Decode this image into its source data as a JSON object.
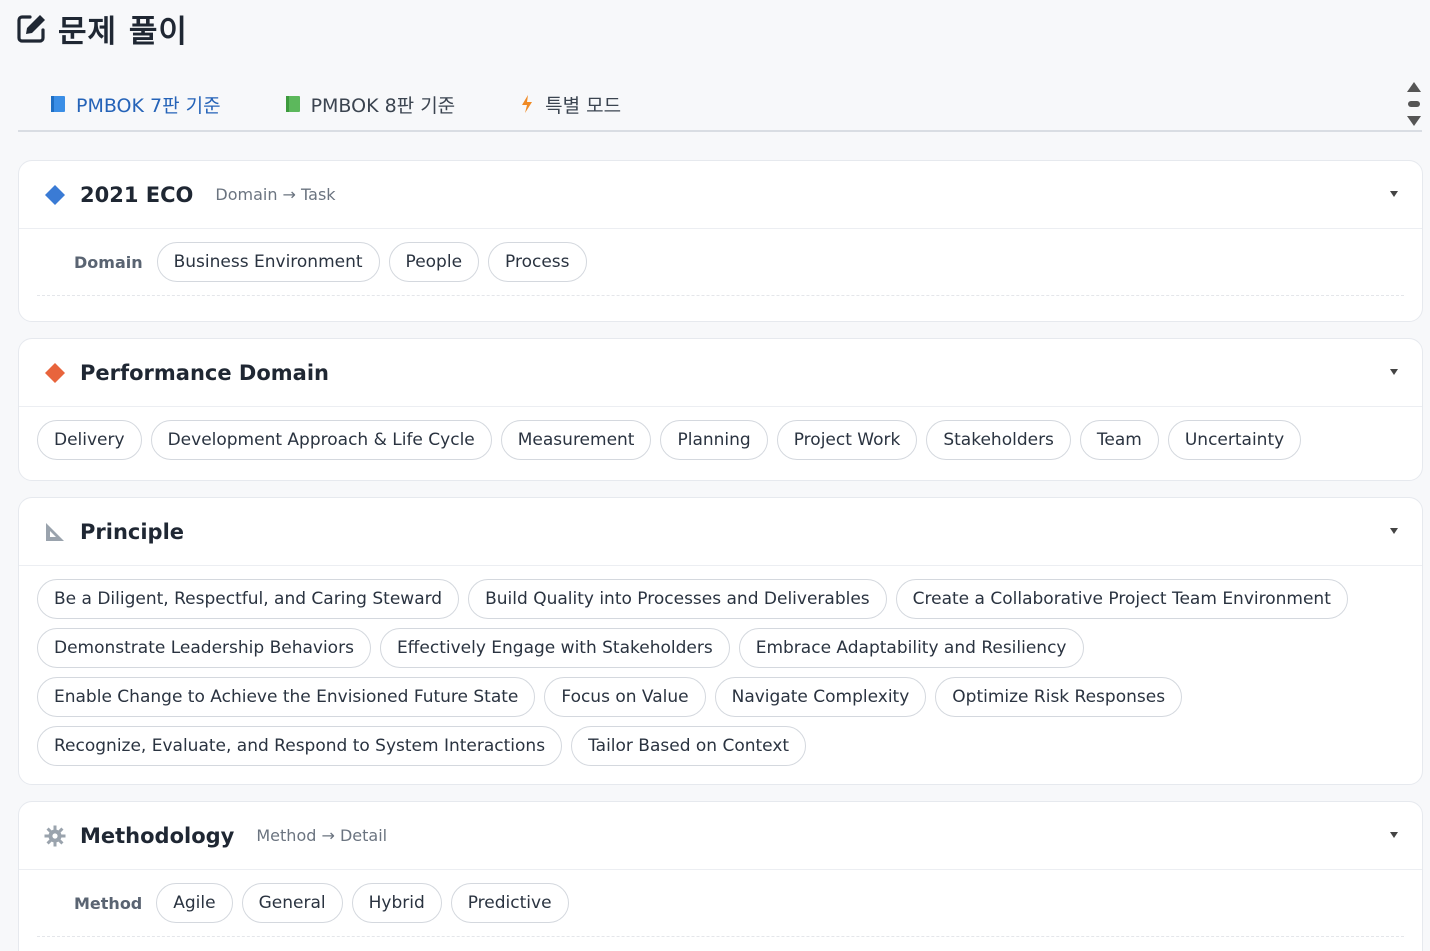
{
  "page": {
    "title": "문제 풀이",
    "title_icon": "edit-icon"
  },
  "tabs": [
    {
      "label": "PMBOK 7판 기준",
      "icon": "blue-book-icon",
      "active": true
    },
    {
      "label": "PMBOK 8판 기준",
      "icon": "green-book-icon",
      "active": false
    },
    {
      "label": "특별 모드",
      "icon": "lightning-icon",
      "active": false
    }
  ],
  "sections": {
    "eco": {
      "title": "2021 ECO",
      "subtitle": "Domain → Task",
      "icon": "blue-diamond-icon",
      "row_label": "Domain",
      "chips": [
        "Business Environment",
        "People",
        "Process"
      ]
    },
    "performance": {
      "title": "Performance Domain",
      "icon": "orange-diamond-icon",
      "chips": [
        "Delivery",
        "Development Approach & Life Cycle",
        "Measurement",
        "Planning",
        "Project Work",
        "Stakeholders",
        "Team",
        "Uncertainty"
      ]
    },
    "principle": {
      "title": "Principle",
      "icon": "triangle-ruler-icon",
      "rows": [
        [
          "Be a Diligent, Respectful, and Caring Steward",
          "Build Quality into Processes and Deliverables",
          "Create a Collaborative Project Team Environment"
        ],
        [
          "Demonstrate Leadership Behaviors",
          "Effectively Engage with Stakeholders",
          "Embrace Adaptability and Resiliency"
        ],
        [
          "Enable Change to Achieve the Envisioned Future State",
          "Focus on Value",
          "Navigate Complexity",
          "Optimize Risk Responses"
        ],
        [
          "Recognize, Evaluate, and Respond to System Interactions",
          "Tailor Based on Context"
        ]
      ]
    },
    "methodology": {
      "title": "Methodology",
      "subtitle": "Method → Detail",
      "icon": "gear-icon",
      "row_label": "Method",
      "chips": [
        "Agile",
        "General",
        "Hybrid",
        "Predictive"
      ]
    }
  },
  "colors": {
    "accent": "#2563b8",
    "blue_diamond": "#3a7bd5",
    "orange_diamond": "#e8643c"
  }
}
